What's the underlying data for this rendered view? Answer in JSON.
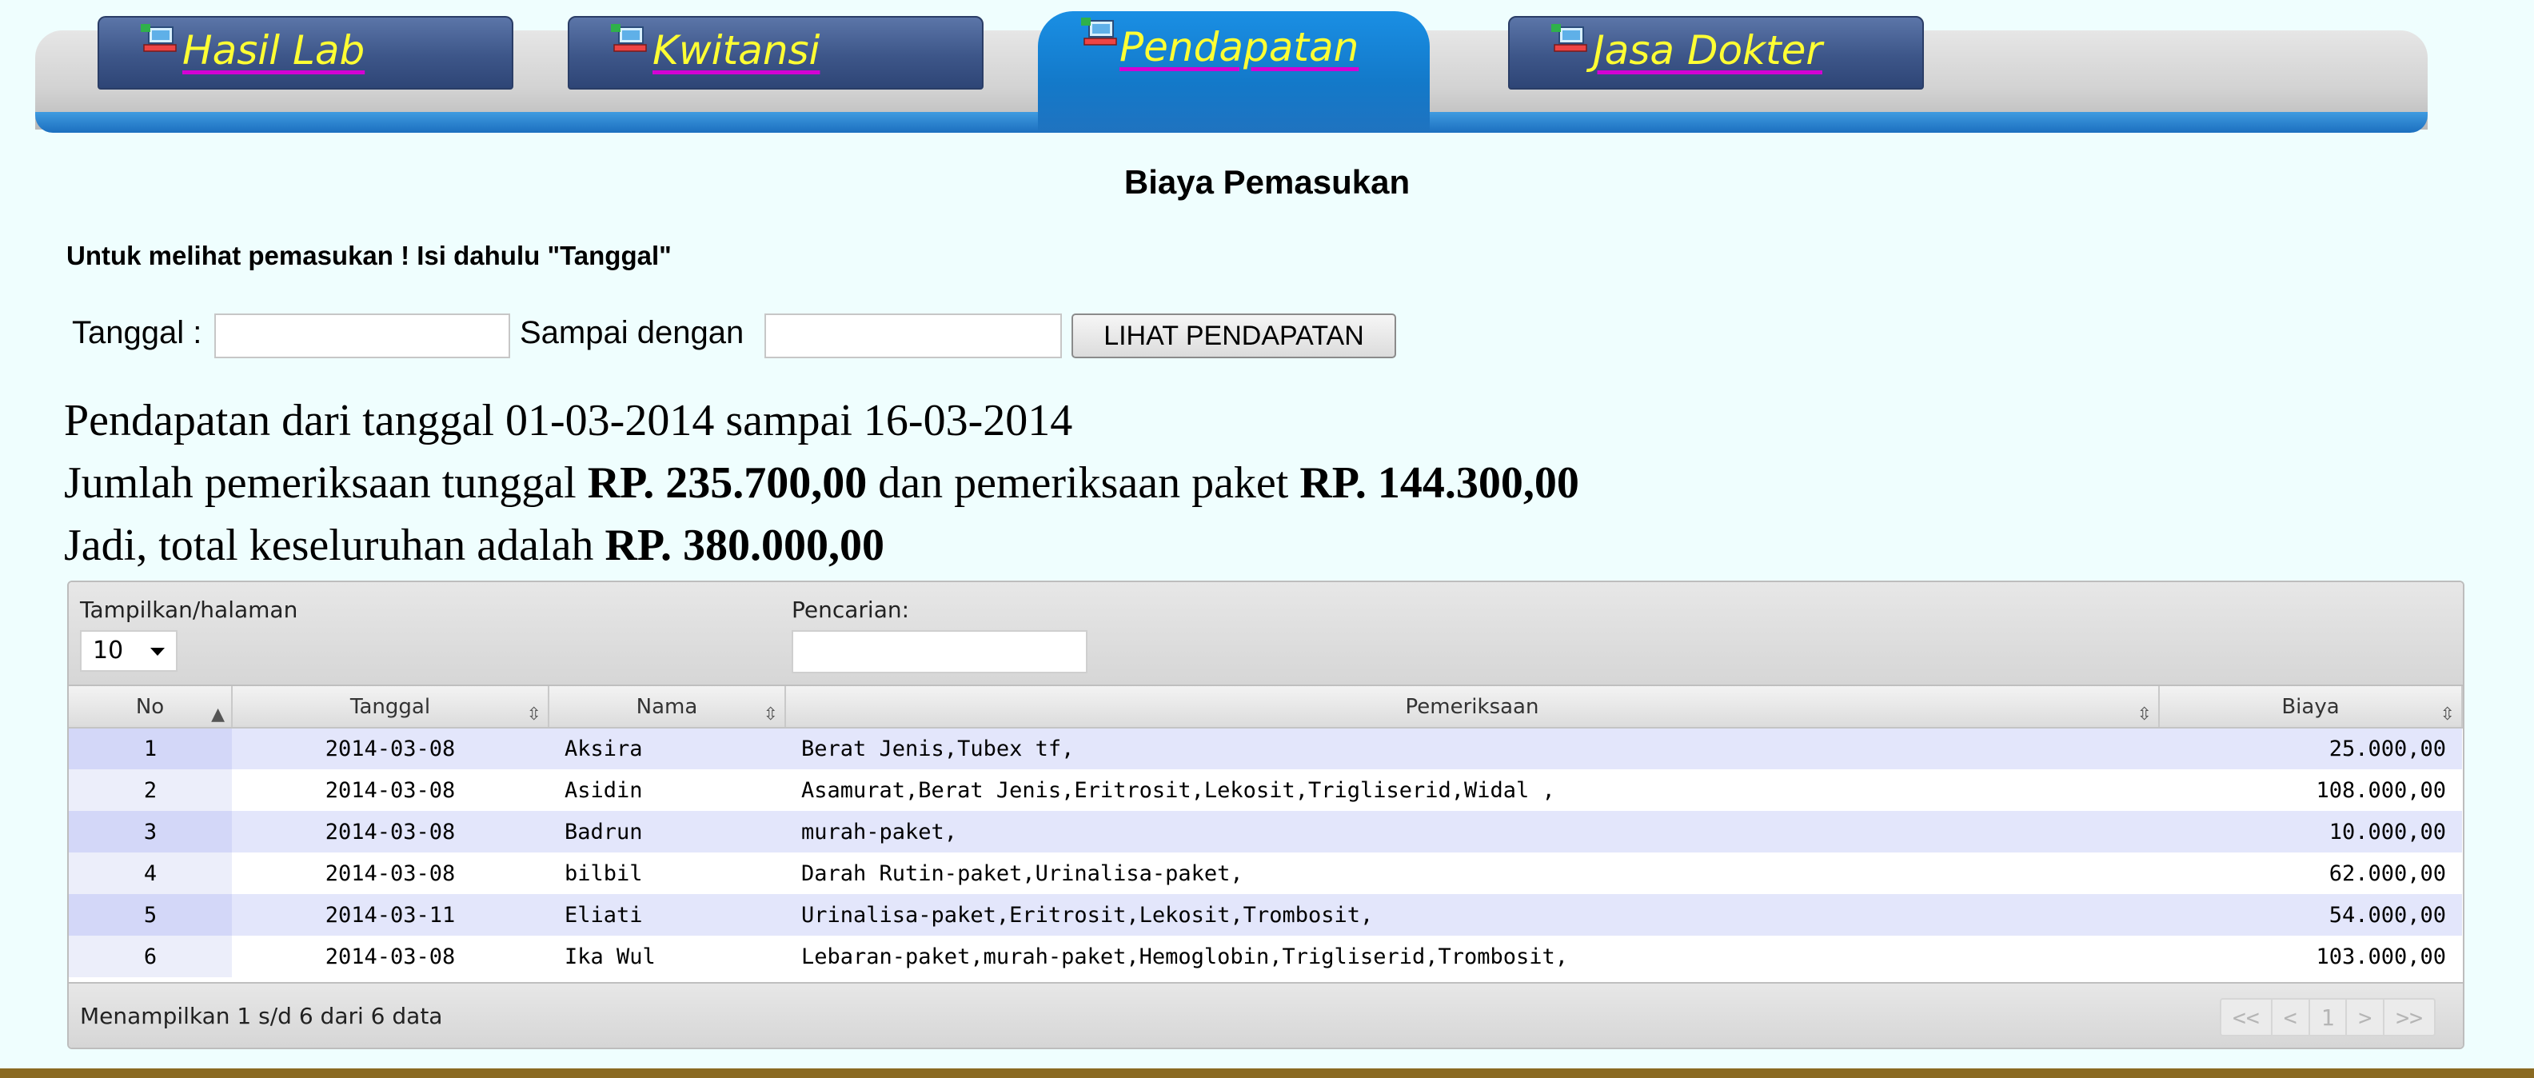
{
  "tabs": [
    {
      "label": "Hasil Lab",
      "active": false
    },
    {
      "label": "Kwitansi",
      "active": false
    },
    {
      "label": "Pendapatan",
      "active": true
    },
    {
      "label": "Jasa Dokter",
      "active": false
    }
  ],
  "page_title": "Biaya Pemasukan",
  "instruction": "Untuk melihat pemasukan ! Isi dahulu \"Tanggal\"",
  "filter": {
    "from_label": "Tanggal :",
    "to_label": "Sampai dengan",
    "from_value": "",
    "to_value": "",
    "button_label": "LIHAT PENDAPATAN"
  },
  "summary": {
    "line1": "Pendapatan dari tanggal 01-03-2014 sampai 16-03-2014",
    "line2_prefix": "Jumlah pemeriksaan tunggal ",
    "line2_amount1": "RP. 235.700,00",
    "line2_middle": " dan pemeriksaan paket ",
    "line2_amount2": "RP. 144.300,00",
    "line3_prefix": "Jadi, total keseluruhan adalah ",
    "line3_amount": "RP. 380.000,00"
  },
  "table": {
    "length_label": "Tampilkan/halaman",
    "length_value": "10",
    "search_label": "Pencarian:",
    "search_value": "",
    "columns": [
      "No",
      "Tanggal",
      "Nama",
      "Pemeriksaan",
      "Biaya"
    ],
    "rows": [
      [
        "1",
        "2014-03-08",
        "Aksira",
        "Berat Jenis,Tubex tf,",
        "25.000,00"
      ],
      [
        "2",
        "2014-03-08",
        "Asidin",
        "Asamurat,Berat Jenis,Eritrosit,Lekosit,Trigliserid,Widal ,",
        "108.000,00"
      ],
      [
        "3",
        "2014-03-08",
        "Badrun",
        "murah-paket,",
        "10.000,00"
      ],
      [
        "4",
        "2014-03-08",
        "bilbil",
        "Darah Rutin-paket,Urinalisa-paket,",
        "62.000,00"
      ],
      [
        "5",
        "2014-03-11",
        "Eliati",
        "Urinalisa-paket,Eritrosit,Lekosit,Trombosit,",
        "54.000,00"
      ],
      [
        "6",
        "2014-03-08",
        "Ika Wul",
        "Lebaran-paket,murah-paket,Hemoglobin,Trigliserid,Trombosit,",
        "103.000,00"
      ]
    ],
    "info": "Menampilkan 1 s/d 6 dari 6 data",
    "pager": {
      "first": "<<",
      "prev": "<",
      "page": "1",
      "next": ">",
      "last": ">>"
    }
  },
  "icons": {
    "tab_icon": "lab-computer-icon",
    "sort": "sort-arrows-icon"
  },
  "colors": {
    "tab_label": "#ffff33",
    "tab_active": "#1a8fe4",
    "tab_inactive": "#3d5689",
    "background": "#effefe"
  }
}
